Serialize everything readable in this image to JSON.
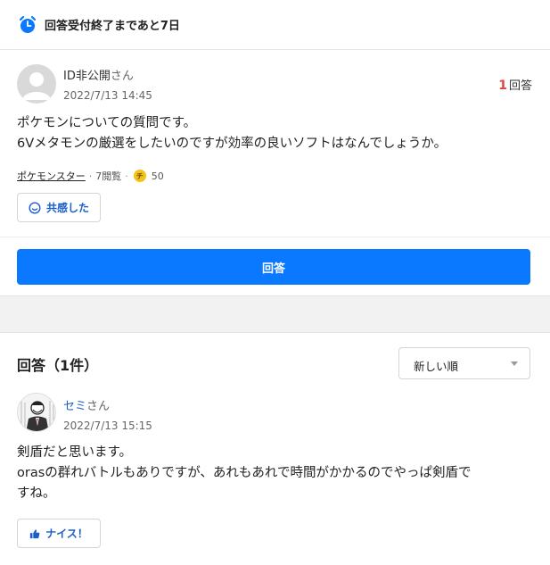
{
  "banner": {
    "text": "回答受付終了まであと7日",
    "icon": "alarm-clock-icon"
  },
  "question": {
    "user_name": "ID非公開",
    "user_suffix": "さん",
    "date": "2022/7/13 14:45",
    "answer_count": "1",
    "answer_count_suffix": "回答",
    "body_line1": "ポケモンについての質問です。",
    "body_line2": "6Vメタモンの厳選をしたいのですが効率の良いソフトはなんでしょうか。",
    "category": "ポケモンスター",
    "views": "7閲覧",
    "coin_icon_text": "チ",
    "coins": "50",
    "empathy_label": "共感した"
  },
  "answer_button": "回答",
  "answers_section": {
    "title": "回答（1件）",
    "sort_value": "新しい順"
  },
  "answer": {
    "user_name": "セミ",
    "user_suffix": "さん",
    "date": "2022/7/13 15:15",
    "body_line1": "剣盾だと思います。",
    "body_line2": "orasの群れバトルもありですが、あれもあれで時間がかかるのでやっぱ剣盾で",
    "body_line3": "すね。",
    "nice_label": "ナイス！"
  },
  "colors": {
    "accent": "#0a78ff",
    "link": "#1a5fc9",
    "count_red": "#e0463e",
    "coin": "#f3c31a"
  }
}
